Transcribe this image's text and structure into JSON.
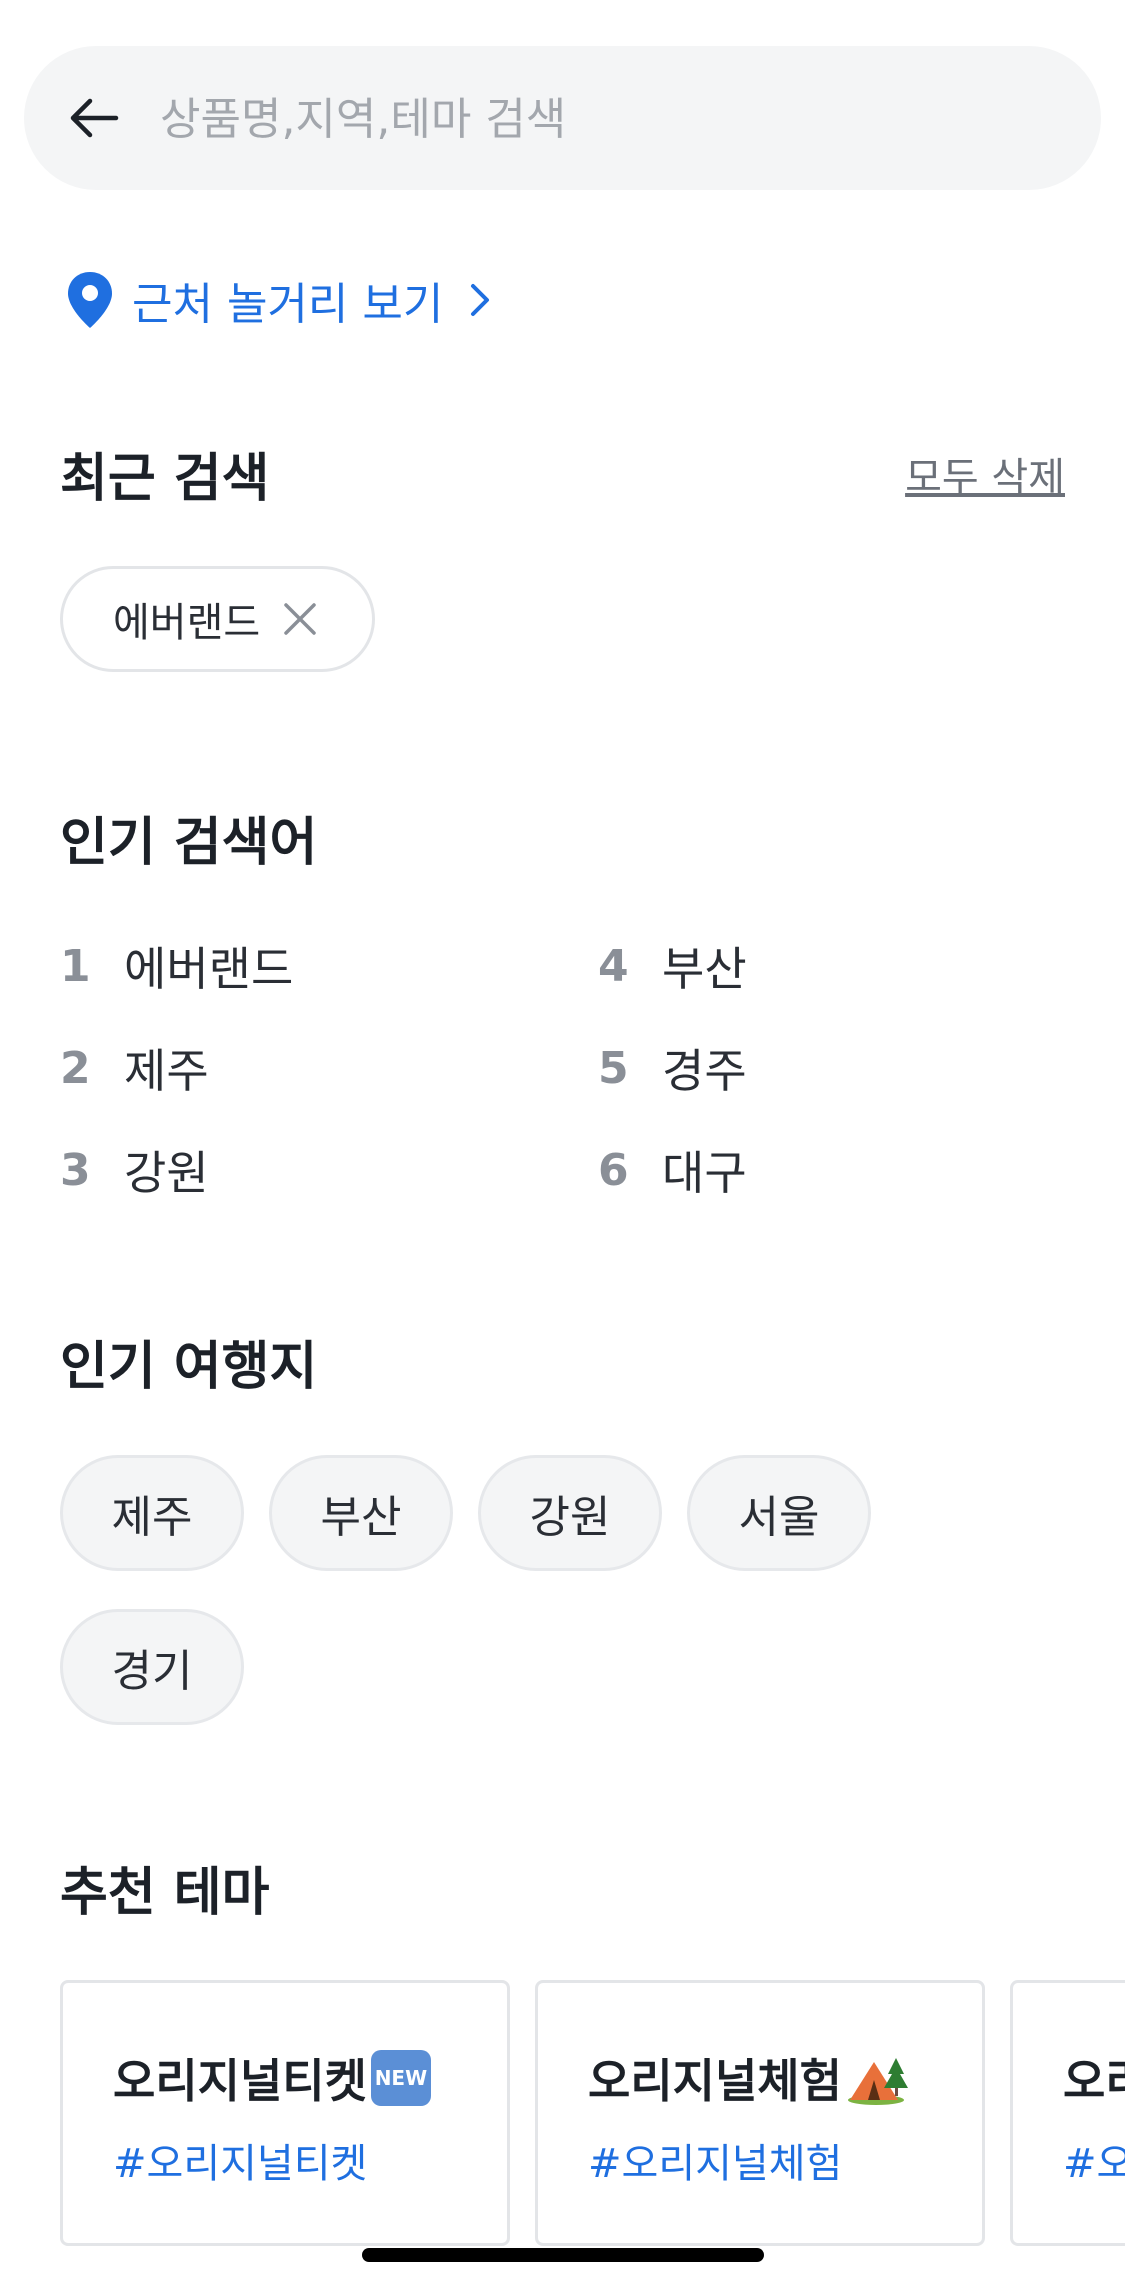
{
  "search": {
    "placeholder": "상품명,지역,테마 검색"
  },
  "nearby": {
    "label": "근처 놀거리 보기"
  },
  "recent": {
    "title": "최근 검색",
    "clear_all": "모두 삭제",
    "items": [
      "에버랜드"
    ]
  },
  "popular_keywords": {
    "title": "인기 검색어",
    "items": [
      {
        "rank": "1",
        "label": "에버랜드"
      },
      {
        "rank": "2",
        "label": "제주"
      },
      {
        "rank": "3",
        "label": "강원"
      },
      {
        "rank": "4",
        "label": "부산"
      },
      {
        "rank": "5",
        "label": "경주"
      },
      {
        "rank": "6",
        "label": "대구"
      }
    ]
  },
  "popular_destinations": {
    "title": "인기 여행지",
    "items": [
      "제주",
      "부산",
      "강원",
      "서울",
      "경기"
    ]
  },
  "themes": {
    "title": "추천 테마",
    "items": [
      {
        "title": "오리지널티켓",
        "tag": "#오리지널티켓",
        "badge": "NEW",
        "icon": "new-icon"
      },
      {
        "title": "오리지널체험",
        "tag": "#오리지널체험",
        "icon": "tent-icon"
      },
      {
        "title": "오리",
        "tag": "#오리"
      }
    ]
  },
  "colors": {
    "accent": "#1f6fe0",
    "background": "#ffffff",
    "chip_background": "#f4f5f6"
  }
}
